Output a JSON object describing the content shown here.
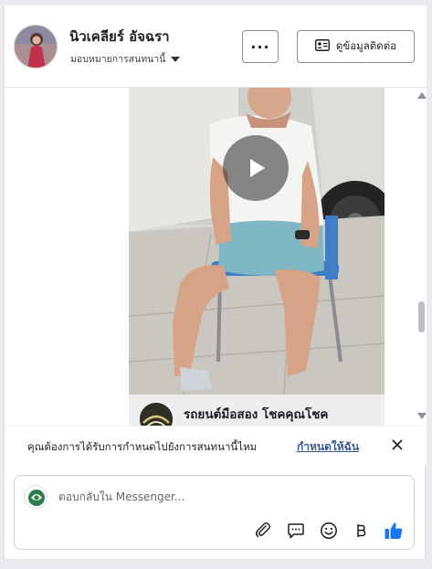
{
  "header": {
    "name": "นิวเคลียร์ อัจฉรา",
    "assign_label": "มอบหมายการสนทนานี้",
    "more_label": "···",
    "contact_label": "ดูข้อมูลติดต่อ"
  },
  "post": {
    "title": "รถยนต์มือสอง โชคคุณโชค"
  },
  "notice": {
    "text": "คุณต้องการได้รับการกำหนดไปยังการสนทนานี้ไหม",
    "link_label": "กำหนดให้ฉัน"
  },
  "composer": {
    "placeholder": "ตอบกลับใน Messenger..."
  },
  "icons": {
    "more": "more-dots-icon",
    "contact": "contact-card-icon",
    "play": "play-icon",
    "close": "close-icon",
    "attach": "paperclip-icon",
    "saved_reply": "chat-bubble-icon",
    "emoji": "emoji-icon",
    "payment": "baht-icon",
    "like": "thumbs-up-icon"
  },
  "colors": {
    "link": "#385898",
    "like_button": "#1877f2",
    "border": "#ccd0d5"
  }
}
